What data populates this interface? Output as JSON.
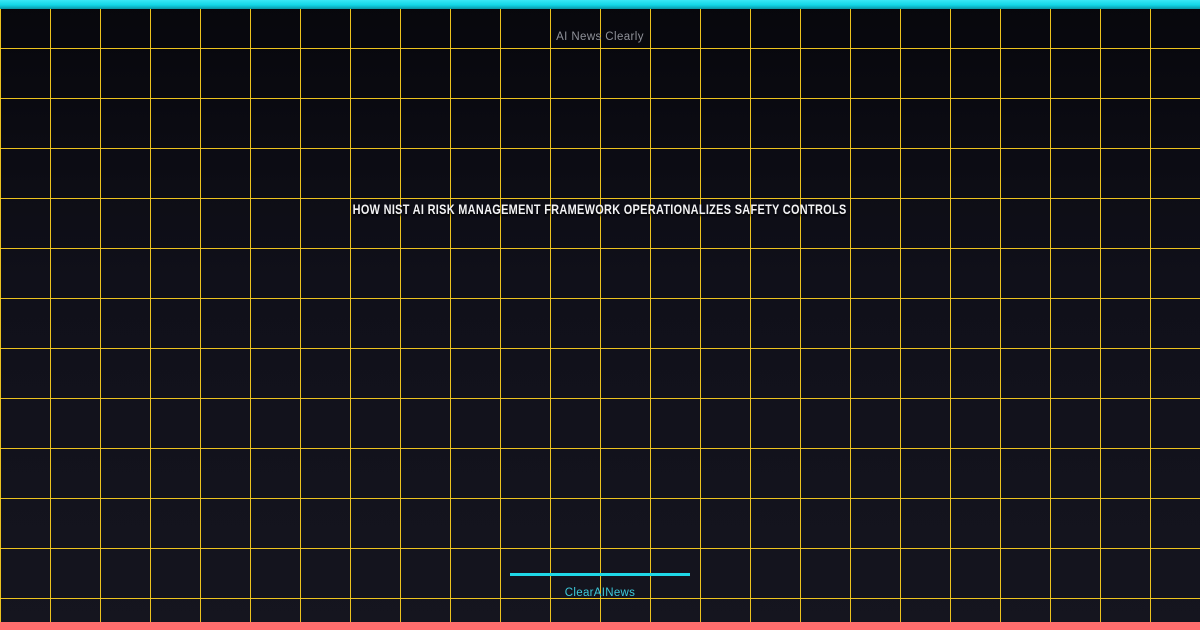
{
  "card": {
    "site_label": "AI News Clearly",
    "headline": "HOW NIST AI RISK MANAGEMENT FRAMEWORK OPERATIONALIZES SAFETY CONTROLS",
    "brand": "ClearAINews"
  },
  "colors": {
    "background_top": "#07070c",
    "background_bottom": "#15151f",
    "grid_yellow": "#ffd21e",
    "top_bar_cyan": "#12d6e6",
    "bottom_bar_coral": "#ff6e6e",
    "site_label_gray": "#8e9098",
    "headline_white": "#f2f2f4",
    "divider_cyan": "#1fd8e8",
    "brand_cyan": "#3cc9da"
  }
}
